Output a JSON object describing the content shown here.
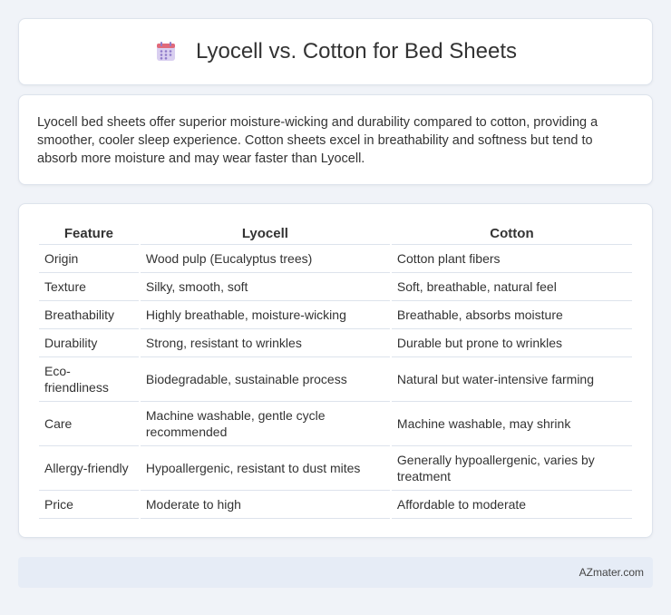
{
  "header": {
    "title": "Lyocell vs. Cotton for Bed Sheets",
    "icon": "calendar-icon",
    "icon_colors": {
      "top": "#e0697a",
      "body": "#c6b8e8",
      "dots": "#8f7bc9"
    }
  },
  "summary": {
    "text": "Lyocell bed sheets offer superior moisture-wicking and durability compared to cotton, providing a smoother, cooler sleep experience. Cotton sheets excel in breathability and softness but tend to absorb more moisture and may wear faster than Lyocell."
  },
  "table": {
    "headers": [
      "Feature",
      "Lyocell",
      "Cotton"
    ],
    "rows": [
      [
        "Origin",
        "Wood pulp (Eucalyptus trees)",
        "Cotton plant fibers"
      ],
      [
        "Texture",
        "Silky, smooth, soft",
        "Soft, breathable, natural feel"
      ],
      [
        "Breathability",
        "Highly breathable, moisture-wicking",
        "Breathable, absorbs moisture"
      ],
      [
        "Durability",
        "Strong, resistant to wrinkles",
        "Durable but prone to wrinkles"
      ],
      [
        "Eco-friendliness",
        "Biodegradable, sustainable process",
        "Natural but water-intensive farming"
      ],
      [
        "Care",
        "Machine washable, gentle cycle recommended",
        "Machine washable, may shrink"
      ],
      [
        "Allergy-friendly",
        "Hypoallergenic, resistant to dust mites",
        "Generally hypoallergenic, varies by treatment"
      ],
      [
        "Price",
        "Moderate to high",
        "Affordable to moderate"
      ]
    ]
  },
  "footer": {
    "text": "AZmater.com"
  }
}
